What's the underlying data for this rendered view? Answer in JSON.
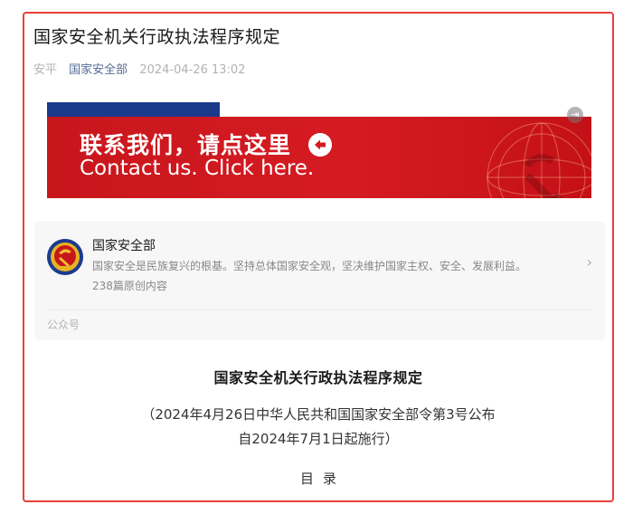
{
  "article": {
    "title": "国家安全机关行政执法程序规定",
    "author": "安平",
    "account": "国家安全部",
    "time": "2024-04-26 13:02"
  },
  "banner": {
    "text_cn": "联系我们，请点这里",
    "text_en": "Contact us. Click here.",
    "colors": {
      "red": "#d51b22",
      "blue": "#1b3a8c"
    }
  },
  "profile_card": {
    "name": "国家安全部",
    "description": "国家安全是民族复兴的根基。坚持总体国家安全观，坚决维护国家主权、安全、发展利益。",
    "count": "238篇原创内容",
    "footer": "公众号"
  },
  "document": {
    "title": "国家安全机关行政执法程序规定",
    "note_line1": "（2024年4月26日中华人民共和国国家安全部令第3号公布",
    "note_line2": "自2024年7月1日起施行）",
    "toc": "目录"
  },
  "accent": {
    "highlight_border": "#e8403a",
    "link": "#576b95"
  }
}
